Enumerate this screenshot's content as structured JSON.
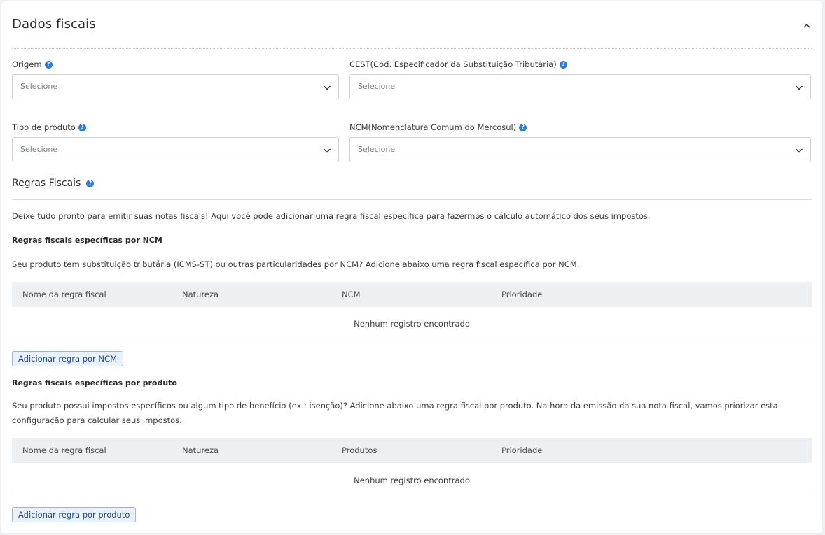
{
  "section": {
    "title": "Dados fiscais"
  },
  "fields": {
    "origem": {
      "label": "Origem",
      "placeholder": "Selecione"
    },
    "cest": {
      "label": "CEST(Cód. Especificador da Substituição Tributária)",
      "placeholder": "Selecione"
    },
    "tipo_produto": {
      "label": "Tipo de produto",
      "placeholder": "Selecione"
    },
    "ncm": {
      "label": "NCM(Nomenclatura Comum do Mercosul)",
      "placeholder": "Selecione"
    }
  },
  "regras": {
    "title": "Regras Fiscais",
    "intro": "Deixe tudo pronto para emitir suas notas fiscais! Aqui você pode adicionar uma regra fiscal específica para fazermos o cálculo automático dos seus impostos.",
    "ncm": {
      "heading": "Regras fiscais específicas por NCM",
      "description": "Seu produto tem substituição tributária (ICMS-ST) ou outras particularidades por NCM? Adicione abaixo uma regra fiscal específica por NCM.",
      "columns": [
        "Nome da regra fiscal",
        "Natureza",
        "NCM",
        "Prioridade"
      ],
      "empty": "Nenhum registro encontrado",
      "button": "Adicionar regra por NCM"
    },
    "produto": {
      "heading": "Regras fiscais específicas por produto",
      "description": "Seu produto possui impostos específicos ou algum tipo de benefício (ex.: isenção)? Adicione abaixo uma regra fiscal por produto. Na hora da emissão da sua nota fiscal, vamos priorizar esta configuração para calcular seus impostos.",
      "columns": [
        "Nome da regra fiscal",
        "Natureza",
        "Produtos",
        "Prioridade"
      ],
      "empty": "Nenhum registro encontrado",
      "button": "Adicionar regra por produto"
    }
  },
  "icons": {
    "help": "question-circle-icon",
    "chevron": "chevron-down-icon",
    "collapse": "chevron-up-icon"
  },
  "colors": {
    "accent": "#2d7bd6",
    "button_text": "#1e4b86",
    "table_header": "#edf0f3"
  }
}
